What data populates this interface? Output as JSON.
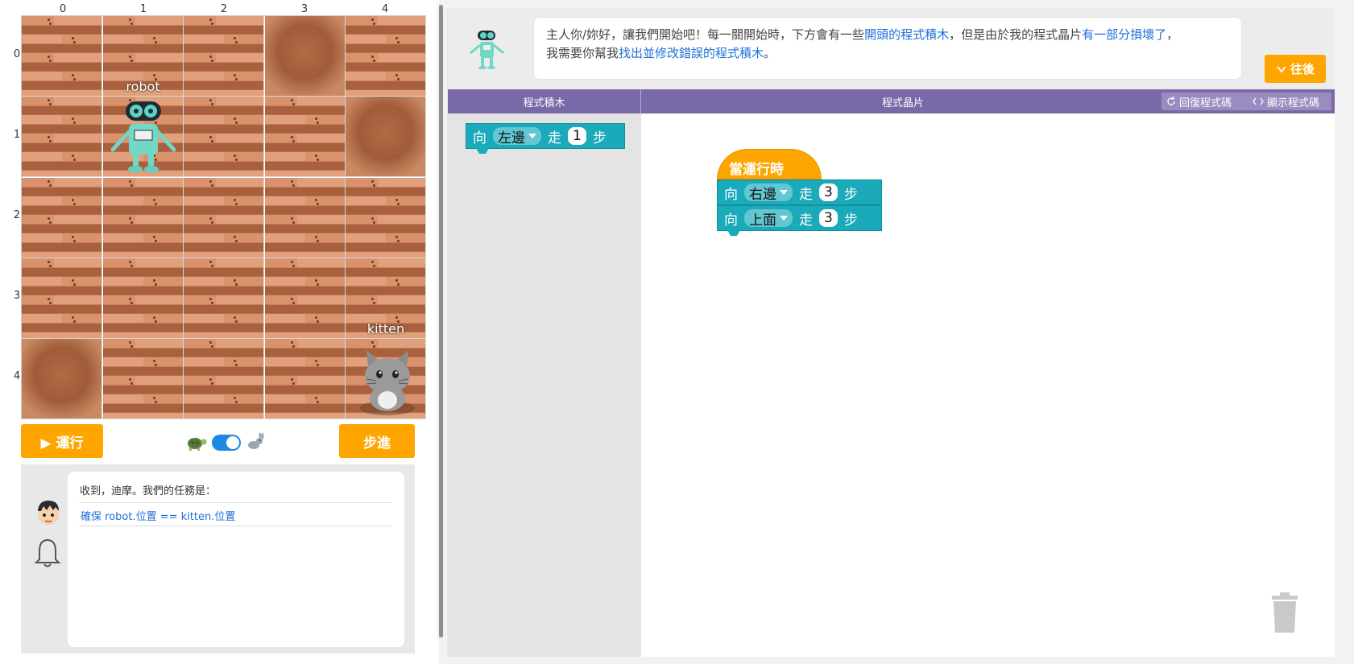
{
  "grid": {
    "col_labels": [
      "0",
      "1",
      "2",
      "3",
      "4"
    ],
    "row_labels": [
      "0",
      "1",
      "2",
      "3",
      "4"
    ],
    "robot_label": "robot",
    "kitten_label": "kitten",
    "robot_cell": {
      "col": 1,
      "row": 1
    },
    "kitten_cell": {
      "col": 4,
      "row": 4
    }
  },
  "controls": {
    "run_label": "▶ 運行",
    "step_label": "步進",
    "speed_slow_icon": "turtle-icon",
    "speed_fast_icon": "rabbit-icon",
    "speed_fast_enabled": true
  },
  "mission": {
    "message": "收到，迪摩。我們的任務是：",
    "goal": "確保 robot.位置 == kitten.位置"
  },
  "header": {
    "intro_part1": "主人你/妳好，讓我們開始吧！每一關開始時，下方會有一些",
    "intro_hl1": "開頭的程式積木",
    "intro_part2": "，但是由於我的程式晶片",
    "intro_hl2": "有一部分損壞了",
    "intro_part3": "，",
    "intro_part4": "我需要你幫我",
    "intro_hl3": "找出並修改錯誤的程式積木",
    "intro_part5": "。",
    "next_label": "往後"
  },
  "toolbar": {
    "blocks_title": "程式積木",
    "chip_title": "程式晶片",
    "reset_label": "回復程式碼",
    "show_label": "顯示程式碼"
  },
  "toolbox": {
    "block": {
      "word_to": "向",
      "direction": "左邊",
      "word_walk": "走",
      "steps": "1",
      "word_step": "步"
    }
  },
  "workspace": {
    "hat": "當運行時",
    "blocks": [
      {
        "word_to": "向",
        "direction": "右邊",
        "word_walk": "走",
        "steps": "3",
        "word_step": "步"
      },
      {
        "word_to": "向",
        "direction": "上面",
        "word_walk": "走",
        "steps": "3",
        "word_step": "步"
      }
    ]
  },
  "colors": {
    "accent_orange": "#ffa500",
    "toolbar_purple": "#7a69a8",
    "block_teal": "#1aaab9",
    "link_blue": "#1e6fd9"
  }
}
